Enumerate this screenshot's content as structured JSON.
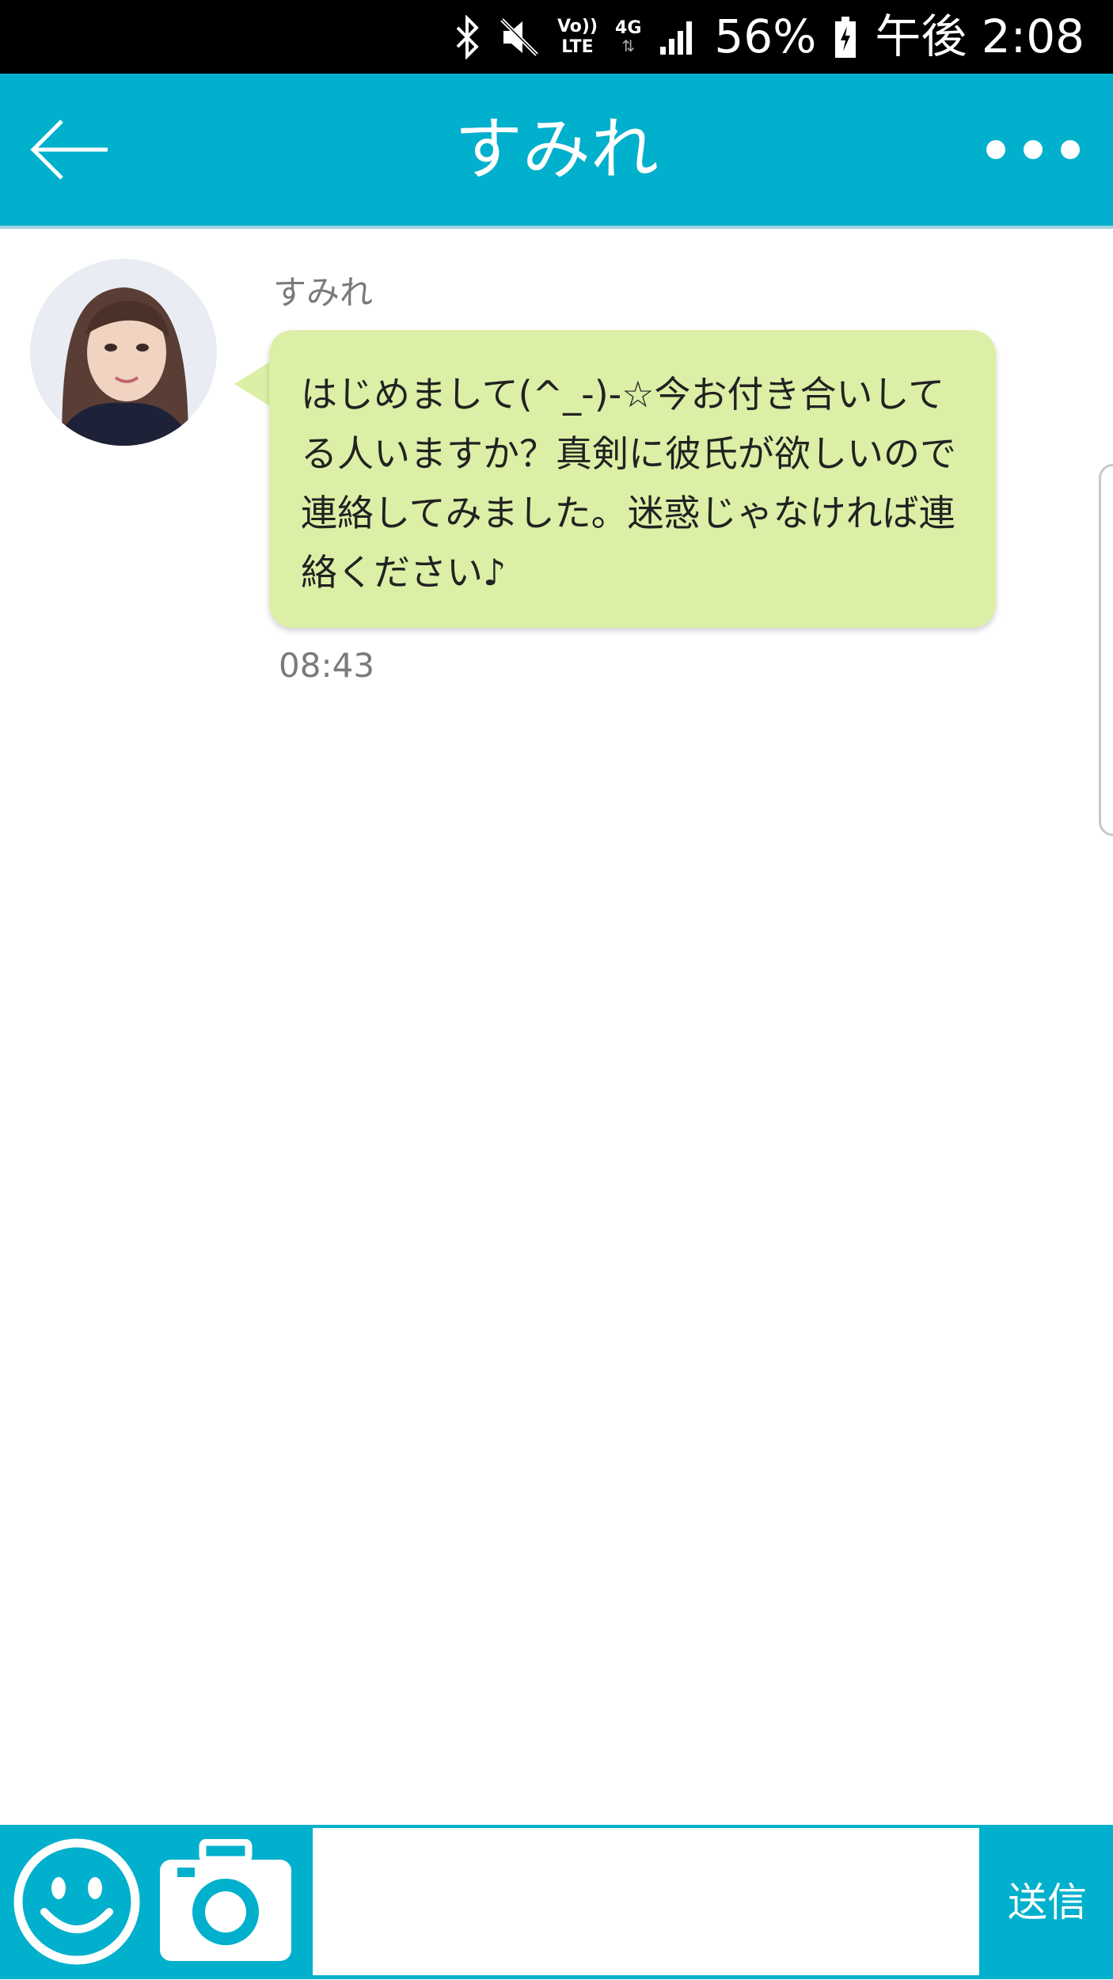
{
  "status_bar": {
    "volte_top": "Vo))",
    "volte_bottom": "LTE",
    "network": "4G",
    "battery": "56%",
    "time": "午後 2:08",
    "icons": [
      "bluetooth-icon",
      "mute-icon",
      "volte-icon",
      "network-4g-icon",
      "signal-icon",
      "battery-icon"
    ]
  },
  "header": {
    "title": "すみれ",
    "back_icon": "back-arrow-icon",
    "menu_icon": "more-dots-icon"
  },
  "messages": [
    {
      "sender": "すみれ",
      "text": "はじめまして(^_-)-☆今お付き合いしてる人いますか？真剣に彼氏が欲しいので連絡してみました。迷惑じゃなければ連絡ください♪",
      "time": "08:43"
    }
  ],
  "composer": {
    "input_value": "",
    "send_label": "送信",
    "emoji_icon": "smiley-icon",
    "camera_icon": "camera-icon"
  },
  "colors": {
    "accent": "#00b0cc",
    "bubble": "#dcefa6",
    "meta_text": "#7a7a7a"
  }
}
